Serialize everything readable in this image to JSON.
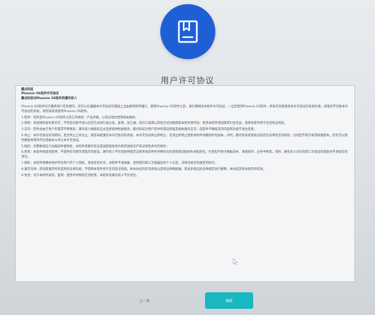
{
  "title": "用户许可协议",
  "license": {
    "heading": [
      "麒点科技",
      "Phoenix OS软件许可协议",
      "麒点科技对Phoenix OS软件的著作权人"
    ],
    "paragraphs": [
      "Phoenix OS软件对于最终用户是免费的，您可以在遵循本许可协议的基础上自由使用和传播它。使用Phoenix OS软件之前，请仔细阅读本软件许可协议，一旦您使用Phoenix OS软件，即表示同意接受本许可协议的条款约束。如果您不同意本许可协议的条款，请勿安装或使用Phoenix OS软件。",
      "1.软件：软件是Phoenix OS软件以及它的更新、产品手册，以及在线文档等相关媒体。",
      "2.限制：未经授权发布者许可，不得且同意不会以任何方式进行再分发、复制、反汇编、逆向工程或以其他方式试图获取本软件源代码，修改本软件或创建其衍生作品，或将本软件用于任何商业用途。",
      "3.支持：软件会由于用户的需求不断更新，著作权人根据您自主选择提供相关服务。麒点科技对用户软件的错误修复及相关服务支持，但软件不确保支持内容和功能不发生变更。",
      "4.终止：本许可协议有效期间，直至终止之日为止。如您未能遵守本许可协议的条款，本许可协议将立即终止，您须立即停止使用本软件并删除所有副本。同时，麒点科技保留依法追究您法律责任的权利，包括但不限于要求赔偿损失。您也可以随时删除本软件的全部副本以终止本许可协议。",
      "5.版权：您需要保证只具备软件使用权，本软件受著作权法及国际版权条约和其他知识产权法律及条约的保护。",
      "6.免责：本软件按现状提供，不提供任何明示或暗示的保证。著作权人不对因使用或无法使用本软件所导致的任何直接或间接损失承担责任，包括但不限于数据丢失、系统损坏、业务中断等。同时，著作权人对任何第三方提出的索赔亦不承担任何责任。",
      "7.隐私：本软件尊重并保护所有用户的个人隐私。未经您的许可，本软件不会收集、使用或向第三方披露您的个人信息，法律法规另有规定的除外。",
      "8.遵守法律：您同意遵守所有适用的法律法规，不得将本软件用于任何违法用途。如本协议的任何条款与适用法律相抵触，则该条款应按法律规定进行解释，本协议其余条款仍然有效。",
      "9.免责：对于本软件安装、复制、使用中导致的任何损害，本软件及著作权人不负责任。"
    ]
  },
  "buttons": {
    "prev": "上一步",
    "next": "接受"
  },
  "colors": {
    "brand_blue": "#1f5fd6",
    "accept_teal": "#17b8c0"
  },
  "icons": {
    "logo": "bookmark-document-icon",
    "cursor": "mouse-pointer-icon"
  }
}
